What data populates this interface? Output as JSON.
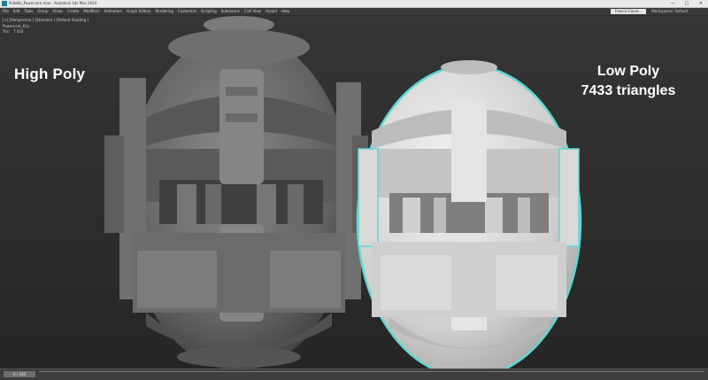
{
  "window": {
    "title": "PolloBo_Powercore.max - Autodesk 3ds Max 2024",
    "controls": [
      "—",
      "□",
      "✕"
    ]
  },
  "menubar": {
    "items": [
      "File",
      "Edit",
      "Tools",
      "Group",
      "Views",
      "Create",
      "Modifiers",
      "Animation",
      "Graph Editors",
      "Rendering",
      "Customize",
      "Scripting",
      "Substance",
      "Civil View",
      "Arnold",
      "Help"
    ],
    "user_button": "Francis Cours...",
    "workspace_label": "Workspaces:",
    "workspace_value": "Default"
  },
  "viewport": {
    "label": "[+] [Perspective ] [Standard ] [Default Shading ]",
    "stats": {
      "object_name": "Powercore_01a",
      "polys_key": "Tris:",
      "polys_value": "7 433"
    },
    "annotations": {
      "high_poly": "High Poly",
      "low_poly_title": "Low Poly",
      "low_poly_count": "7433 triangles"
    }
  },
  "timeline": {
    "frame_label": "0 / 100"
  },
  "colors": {
    "viewport_bg": "#2e2e2e",
    "highpoly_mesh": "#6d6d6d",
    "lowpoly_mesh": "#d4d4d4",
    "selection_outline": "#5fd6d8"
  }
}
